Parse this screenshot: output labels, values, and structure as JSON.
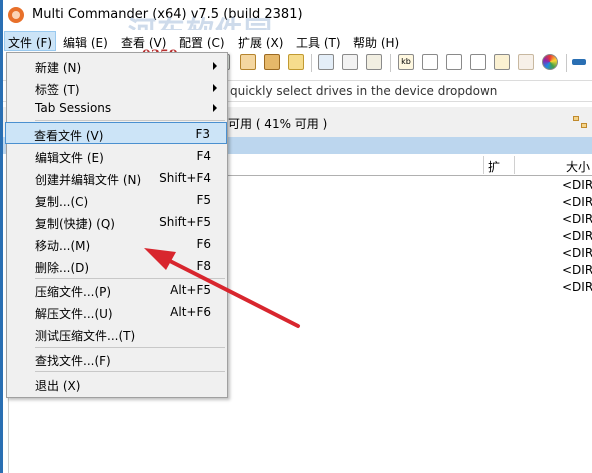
{
  "window": {
    "title": "Multi Commander (x64)  v7.5 (build 2381)"
  },
  "watermark": {
    "brand": "河东软件园",
    "url": "www.pc0359.cn"
  },
  "menubar": {
    "items": [
      {
        "label": "文件 (F)"
      },
      {
        "label": "编辑 (E)"
      },
      {
        "label": "查看 (V)"
      },
      {
        "label": "配置 (C)"
      },
      {
        "label": "扩展 (X)"
      },
      {
        "label": "工具 (T)"
      },
      {
        "label": "帮助 (H)"
      }
    ]
  },
  "toolbar": {
    "icons": [
      "copy-icon",
      "image-icon",
      "package-icon",
      "folder-new-icon",
      "search-icon",
      "edit-icon",
      "binoculars-icon",
      "kb-icon",
      "document-icon",
      "document-icon",
      "document-icon",
      "note-icon",
      "wand-icon",
      "color-wheel-icon",
      "separator-icon"
    ],
    "kb_label": "kb"
  },
  "hint": {
    "text": "quickly select drives in the device dropdown"
  },
  "drive_info": {
    "text": "可用 ( 41% 可用 )"
  },
  "file_panel": {
    "columns": [
      {
        "label": "扩"
      },
      {
        "label": "大小"
      }
    ],
    "rows": [
      {
        "size": "<DIR>"
      },
      {
        "size": "<DIR>"
      },
      {
        "size": "<DIR>"
      },
      {
        "size": "<DIR>"
      },
      {
        "size": "<DIR>"
      },
      {
        "size": "<DIR>"
      },
      {
        "size": "<DIR>"
      }
    ]
  },
  "context_menu": {
    "items": [
      {
        "label": "新建 (N)",
        "shortcut": "",
        "submenu": true
      },
      {
        "label": "标签 (T)",
        "shortcut": "",
        "submenu": true
      },
      {
        "label": "Tab Sessions",
        "shortcut": "",
        "submenu": true
      },
      {
        "label": "查看文件 (V)",
        "shortcut": "F3",
        "highlighted": true
      },
      {
        "label": "编辑文件 (E)",
        "shortcut": "F4"
      },
      {
        "label": "创建并编辑文件 (N)",
        "shortcut": "Shift+F4"
      },
      {
        "label": "复制...(C)",
        "shortcut": "F5"
      },
      {
        "label": "复制(快捷) (Q)",
        "shortcut": "Shift+F5"
      },
      {
        "label": "移动...(M)",
        "shortcut": "F6"
      },
      {
        "label": "删除...(D)",
        "shortcut": "F8"
      },
      {
        "label": "压缩文件...(P)",
        "shortcut": "Alt+F5"
      },
      {
        "label": "解压文件...(U)",
        "shortcut": "Alt+F6"
      },
      {
        "label": "测试压缩文件...(T)",
        "shortcut": ""
      },
      {
        "label": "查找文件...(F)",
        "shortcut": ""
      },
      {
        "label": "退出 (X)",
        "shortcut": ""
      }
    ]
  },
  "colors": {
    "highlight_bg": "#cce4f7",
    "highlight_border": "#4a90d0",
    "annotation_arrow": "#d8262e",
    "panel_strip": "#bcd6ee"
  }
}
